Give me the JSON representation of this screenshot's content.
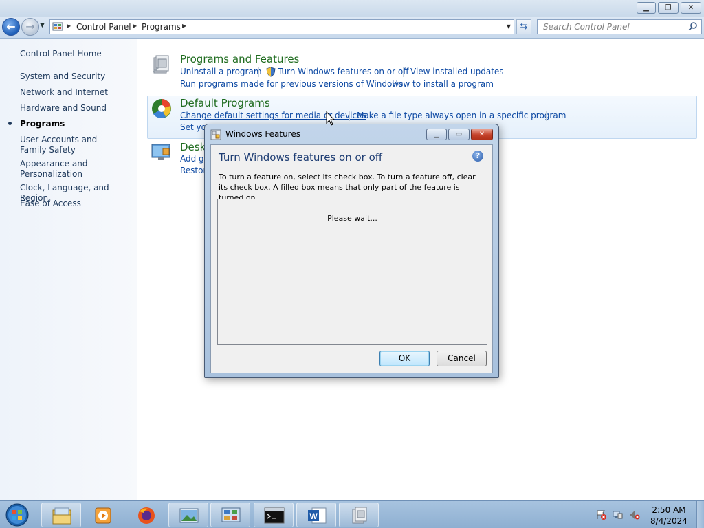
{
  "window": {
    "caption_buttons": [
      "minimize",
      "restore",
      "close"
    ]
  },
  "nav": {
    "breadcrumbs": [
      "Control Panel",
      "Programs"
    ],
    "search_placeholder": "Search Control Panel"
  },
  "sidebar": {
    "home": "Control Panel Home",
    "items": [
      {
        "label": "System and Security"
      },
      {
        "label": "Network and Internet"
      },
      {
        "label": "Hardware and Sound"
      },
      {
        "label": "Programs",
        "active": true
      },
      {
        "label": "User Accounts and Family Safety"
      },
      {
        "label": "Appearance and Personalization"
      },
      {
        "label": "Clock, Language, and Region"
      },
      {
        "label": "Ease of Access"
      }
    ]
  },
  "categories": {
    "programs_features": {
      "title": "Programs and Features",
      "links": [
        "Uninstall a program",
        "Turn Windows features on or off",
        "View installed updates",
        "Run programs made for previous versions of Windows",
        "How to install a program"
      ]
    },
    "default_programs": {
      "title": "Default Programs",
      "links": [
        "Change default settings for media or devices",
        "Make a file type always open in a specific program",
        "Set yo"
      ]
    },
    "desktop_gadgets": {
      "title": "Desk",
      "links": [
        "Add ga",
        "Restor"
      ]
    }
  },
  "dialog": {
    "title": "Windows Features",
    "heading": "Turn Windows features on or off",
    "description": "To turn a feature on, select its check box. To turn a feature off, clear its check box. A filled box means that only part of the feature is turned on.",
    "status": "Please wait...",
    "ok_label": "OK",
    "cancel_label": "Cancel",
    "help_glyph": "?"
  },
  "taskbar": {
    "apps": [
      "windows-explorer",
      "media-player",
      "firefox",
      "photo-viewer",
      "control-panel",
      "command-prompt",
      "microsoft-word",
      "programs-and-features"
    ],
    "clock": {
      "time": "2:50 AM",
      "date": "8/4/2024"
    },
    "tray": [
      "action-center-error-icon",
      "network-error-icon",
      "volume-muted-icon"
    ]
  },
  "colors": {
    "link": "#0d49a3",
    "category_title": "#1e6b1e",
    "sidebar_text": "#1e395b",
    "dialog_heading": "#1e3d73"
  }
}
